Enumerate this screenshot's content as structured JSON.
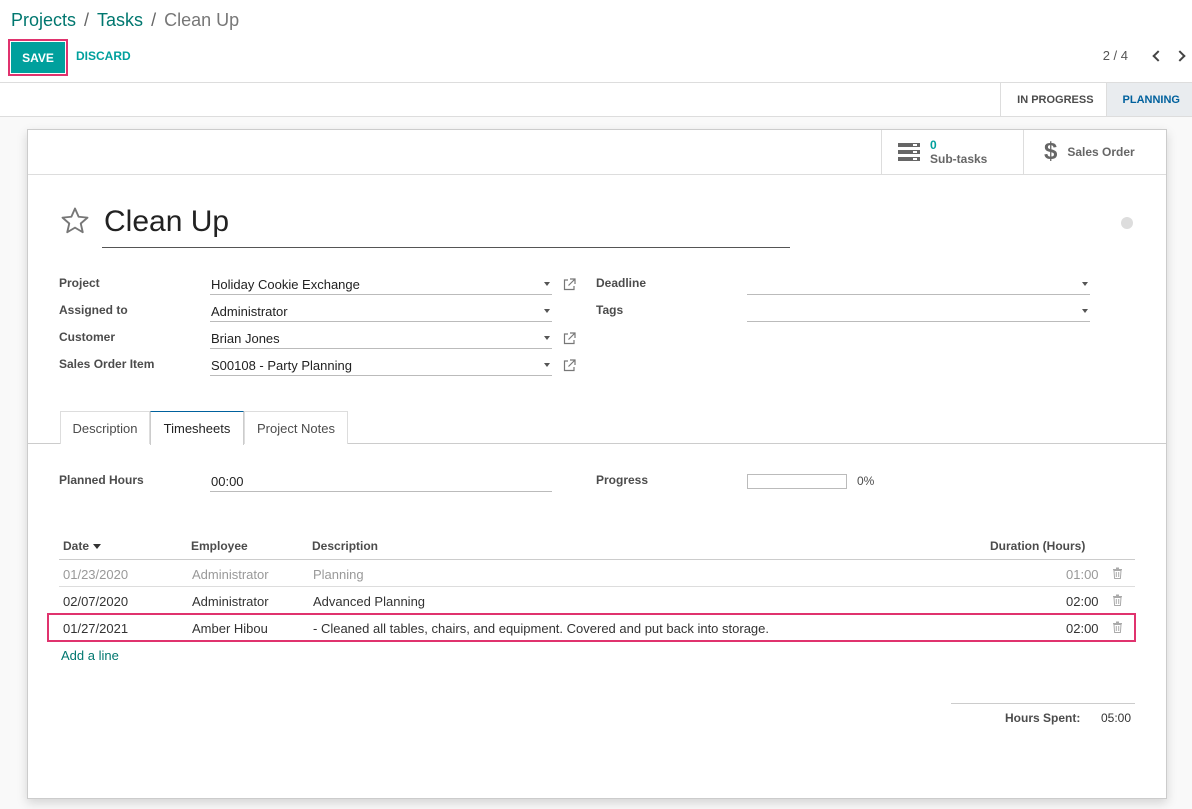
{
  "breadcrumb": {
    "items": [
      "Projects",
      "Tasks"
    ],
    "separator": "/",
    "current": "Clean Up"
  },
  "actions": {
    "save": "SAVE",
    "discard": "DISCARD"
  },
  "pager": {
    "value": "2 / 4"
  },
  "stages": [
    {
      "label": "IN PROGRESS",
      "active": false
    },
    {
      "label": "PLANNING",
      "active": true
    }
  ],
  "smart_buttons": {
    "subtasks": {
      "value": "0",
      "label": "Sub-tasks",
      "icon": "list-icon"
    },
    "sales_order": {
      "label": "Sales Order",
      "icon": "dollar-icon"
    }
  },
  "task": {
    "title": "Clean Up",
    "starred": false
  },
  "fields": {
    "project": {
      "label": "Project",
      "value": "Holiday Cookie Exchange"
    },
    "assigned_to": {
      "label": "Assigned to",
      "value": "Administrator"
    },
    "customer": {
      "label": "Customer",
      "value": "Brian Jones"
    },
    "sales_order_item": {
      "label": "Sales Order Item",
      "value": "S00108 - Party Planning"
    },
    "deadline": {
      "label": "Deadline",
      "value": ""
    },
    "tags": {
      "label": "Tags",
      "value": ""
    }
  },
  "tabs": [
    {
      "label": "Description",
      "active": false
    },
    {
      "label": "Timesheets",
      "active": true
    },
    {
      "label": "Project Notes",
      "active": false
    }
  ],
  "timesheets": {
    "planned_hours": {
      "label": "Planned Hours",
      "value": "00:00"
    },
    "progress": {
      "label": "Progress",
      "value": 0,
      "display": "0%"
    },
    "columns": {
      "date": "Date",
      "employee": "Employee",
      "description": "Description",
      "duration": "Duration (Hours)"
    },
    "rows": [
      {
        "date": "01/23/2020",
        "employee": "Administrator",
        "description": "Planning",
        "duration": "01:00",
        "muted": true
      },
      {
        "date": "02/07/2020",
        "employee": "Administrator",
        "description": "Advanced Planning",
        "duration": "02:00",
        "muted": false
      },
      {
        "date": "01/27/2021",
        "employee": "Amber Hibou",
        "description": "- Cleaned all tables, chairs, and equipment. Covered and put back into storage.",
        "duration": "02:00",
        "muted": false
      }
    ],
    "add_line": "Add a line",
    "total": {
      "label": "Hours Spent:",
      "value": "05:00"
    }
  },
  "colors": {
    "accent": "#00a09d",
    "link": "#00776f",
    "highlight": "#e0336e"
  }
}
